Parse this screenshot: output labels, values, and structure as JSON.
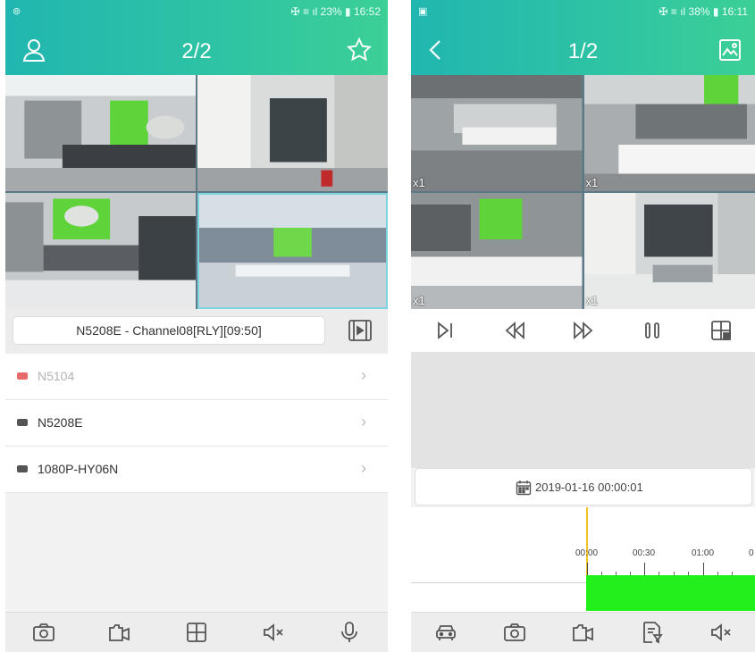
{
  "left": {
    "status_left": "⊚",
    "status_right": "✠ ≡ ıl 23% ▮ 16:52",
    "title": "2/2",
    "channel_label": "N5208E - Channel08[RLY][09:50]",
    "devices": [
      {
        "name": "N5104",
        "online": false
      },
      {
        "name": "N5208E",
        "online": true
      },
      {
        "name": "1080P-HY06N",
        "online": true
      }
    ],
    "chevron": "›",
    "colors": {
      "header_start": "#21b6b0",
      "header_end": "#3ccf96"
    },
    "icons": {
      "header_left": "user-icon",
      "header_right": "star-icon",
      "channel": "video-file-icon",
      "bottom": [
        "camera-icon",
        "record-icon",
        "grid-icon",
        "mute-icon",
        "microphone-icon"
      ]
    }
  },
  "right": {
    "status_left": "▣",
    "status_right": "✠ ≡ ıl 38% ▮ 16:11",
    "title": "1/2",
    "speeds": [
      "x1",
      "x1",
      "x1",
      "x1"
    ],
    "date": "2019-01-16 00:00:01",
    "timeline_ticks": [
      "00:00",
      "00:30",
      "01:00",
      "0"
    ],
    "colors": {
      "record_segment": "#22f01c",
      "cursor": "#f0c320"
    },
    "icons": {
      "header_left": "back-icon",
      "header_right": "image-icon",
      "controls": [
        "step-forward-icon",
        "rewind-icon",
        "fast-forward-icon",
        "pause-icon",
        "layout-icon"
      ],
      "bottom": [
        "car-icon",
        "camera-icon",
        "record-icon",
        "file-search-icon",
        "mute-icon"
      ]
    }
  }
}
